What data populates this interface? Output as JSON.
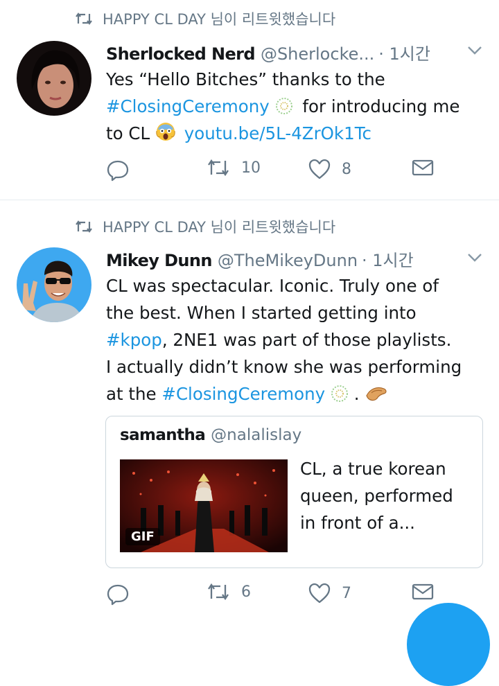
{
  "tweets": [
    {
      "retweet_text": "HAPPY CL DAY 님이 리트윗했습니다",
      "name": "Sherlocked Nerd",
      "handle": "@Sherlocke...",
      "time": "· 1시간",
      "body": {
        "line1": "Yes “Hello Bitches” thanks to the",
        "hashtag": "#ClosingCeremony",
        "line2_rest": "for introducing me",
        "line3_start": "to CL",
        "link": "youtu.be/5L-4ZrOk1Tc"
      },
      "retweets": "10",
      "likes": "8"
    },
    {
      "retweet_text": "HAPPY CL DAY 님이 리트윗했습니다",
      "name": "Mikey Dunn",
      "handle": "@TheMikeyDunn",
      "time": "· 1시간",
      "body": {
        "line1": "CL was spectacular. Iconic. Truly one of",
        "line2": "the best. When I started getting into",
        "hashtag1": "#kpop",
        "line3_rest": ", 2NE1 was part of those playlists.",
        "line4": "I actually didn’t know she was performing",
        "line5_start": "at the",
        "hashtag2": "#ClosingCeremony",
        "line5_end": "."
      },
      "quote": {
        "name": "samantha",
        "handle": "@nalalislay",
        "text": "CL, a true korean queen, performed in front of a...",
        "media_badge": "GIF"
      },
      "retweets": "6",
      "likes": "7"
    }
  ],
  "colors": {
    "accent": "#1b95e0",
    "muted": "#657786",
    "divider": "#e6ecf0"
  }
}
